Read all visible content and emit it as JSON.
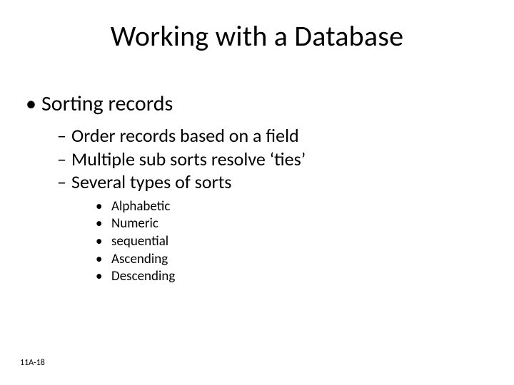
{
  "title": "Working with a Database",
  "lvl1": "Sorting records",
  "lvl2": [
    "Order records based on a field",
    "Multiple sub sorts resolve ‘ties’",
    "Several types of sorts"
  ],
  "lvl3": [
    "Alphabetic",
    "Numeric",
    "sequential",
    "Ascending",
    "Descending"
  ],
  "footer": "11A-18"
}
